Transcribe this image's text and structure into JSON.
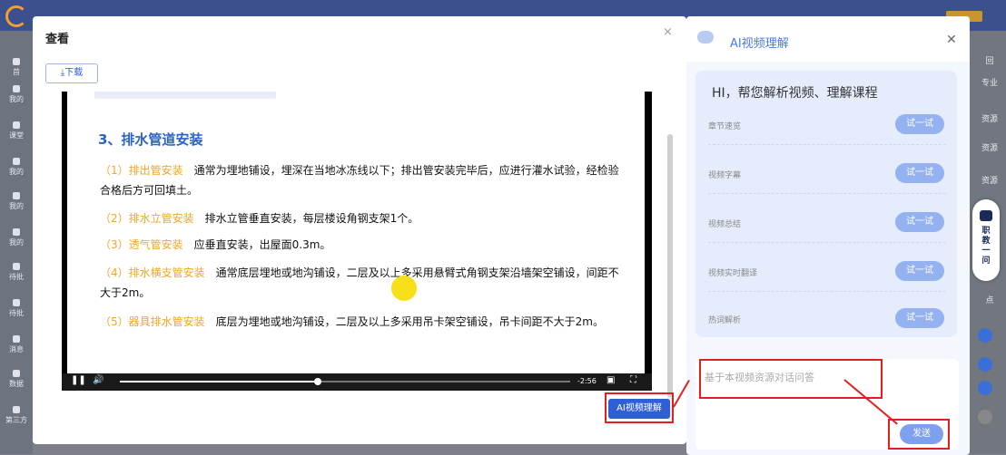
{
  "background": {
    "sidebar_items": [
      "首",
      "我的",
      "课堂",
      "我的",
      "我的",
      "我的",
      "待批",
      "待批",
      "消息",
      "数据",
      "第三方"
    ],
    "right_items": [
      "回",
      "专业",
      "资源",
      "资源",
      "资源",
      "点"
    ],
    "float_widget": "职教一问"
  },
  "dialog": {
    "title": "查看",
    "close_icon": "×",
    "download_label": "下载"
  },
  "video": {
    "heading": "3、排水管道安装",
    "items": [
      {
        "num": "（1）",
        "term": "排出管安装",
        "text": "通常为埋地铺设，埋深在当地冰冻线以下；排出管安装完毕后，应进行灌水试验，经检验合格后方可回填土。"
      },
      {
        "num": "（2）",
        "term": "排水立管安装",
        "text": "排水立管垂直安装，每层楼设角钢支架1个。"
      },
      {
        "num": "（3）",
        "term": "透气管安装",
        "text": "应垂直安装，出屋面0.3m。"
      },
      {
        "num": "（4）",
        "term": "排水横支管安装",
        "text": "通常底层埋地或地沟铺设，二层及以上多采用悬臂式角钢支架沿墙架空铺设，间距不大于2m。"
      },
      {
        "num": "（5）",
        "term": "器具排水管安装",
        "text": "底层为埋地或地沟铺设，二层及以上多采用吊卡架空铺设，吊卡间距不大于2m。"
      }
    ],
    "time": "-2:56",
    "play_progress": 0.44
  },
  "ai_button_label": "AI视频理解",
  "panel": {
    "title": "AI视频理解",
    "greeting": "HI，帮您解析视频、理解课程",
    "features": [
      {
        "label": "章节速览",
        "button": "试一试"
      },
      {
        "label": "视频字幕",
        "button": "试一试"
      },
      {
        "label": "视频总结",
        "button": "试一试"
      },
      {
        "label": "视频实时翻译",
        "button": "试一试"
      },
      {
        "label": "热词解析",
        "button": "试一试"
      }
    ],
    "chat_placeholder": "基于本视频资源对话问答",
    "send_label": "发送"
  },
  "colors": {
    "accent": "#2e5fd6",
    "heading": "#2b62c8",
    "term": "#f2a62a",
    "annotation": "#e02020"
  }
}
